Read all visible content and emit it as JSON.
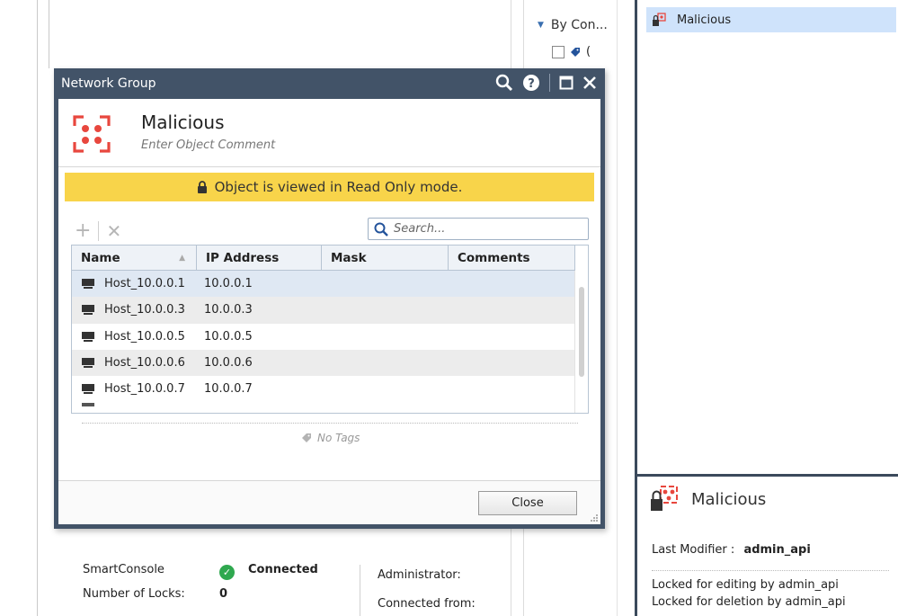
{
  "background": {
    "tree_item": "By Con...",
    "tag_marker": "(",
    "status": {
      "smartconsole_label": "SmartConsole",
      "smartconsole_value": "Connected",
      "locks_label": "Number of Locks:",
      "locks_value": "0",
      "administrator_label": "Administrator:",
      "connected_from_label": "Connected from:"
    }
  },
  "right_panel": {
    "selected_item": "Malicious",
    "details_title": "Malicious",
    "last_modifier_label": "Last Modifier :",
    "last_modifier_value": "admin_api",
    "locked_editing": "Locked for editing by admin_api",
    "locked_deletion": "Locked for deletion by admin_api"
  },
  "dialog": {
    "window_title": "Network Group",
    "object_name": "Malicious",
    "comment_placeholder": "Enter Object Comment",
    "readonly_banner": "Object is viewed in Read Only mode.",
    "search_placeholder": "Search...",
    "columns": [
      "Name",
      "IP Address",
      "Mask",
      "Comments"
    ],
    "members": [
      {
        "name": "Host_10.0.0.1",
        "ip": "10.0.0.1",
        "mask": "",
        "comments": ""
      },
      {
        "name": "Host_10.0.0.3",
        "ip": "10.0.0.3",
        "mask": "",
        "comments": ""
      },
      {
        "name": "Host_10.0.0.5",
        "ip": "10.0.0.5",
        "mask": "",
        "comments": ""
      },
      {
        "name": "Host_10.0.0.6",
        "ip": "10.0.0.6",
        "mask": "",
        "comments": ""
      },
      {
        "name": "Host_10.0.0.7",
        "ip": "10.0.0.7",
        "mask": "",
        "comments": ""
      }
    ],
    "no_tags": "No Tags",
    "close_label": "Close"
  },
  "colors": {
    "titlebar": "#425368",
    "banner": "#f8d44a",
    "selected_row": "#dfe8f3",
    "group_icon": "#e8473e",
    "connected": "#2fa84f"
  }
}
